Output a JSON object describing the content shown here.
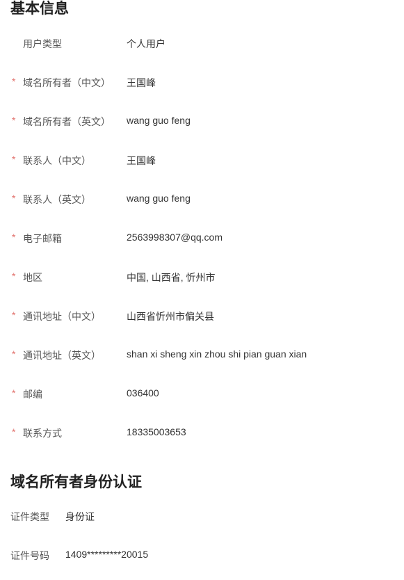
{
  "colors": {
    "required_marker": "#e2726d",
    "label": "#555555",
    "value": "#333333",
    "title": "#222222"
  },
  "basic_info": {
    "title": "基本信息",
    "required_marker": "*",
    "rows": [
      {
        "label": "用户类型",
        "value": "个人用户",
        "required": false
      },
      {
        "label": "域名所有者（中文）",
        "value": "王国峰",
        "required": true
      },
      {
        "label": "域名所有者（英文）",
        "value": "wang guo feng",
        "required": true
      },
      {
        "label": "联系人（中文）",
        "value": "王国峰",
        "required": true
      },
      {
        "label": "联系人（英文）",
        "value": "wang guo feng",
        "required": true
      },
      {
        "label": "电子邮箱",
        "value": "2563998307@qq.com",
        "required": true
      },
      {
        "label": "地区",
        "value": "中国, 山西省, 忻州市",
        "required": true
      },
      {
        "label": "通讯地址（中文）",
        "value": "山西省忻州市偏关县",
        "required": true
      },
      {
        "label": "通讯地址（英文）",
        "value": "shan xi sheng xin zhou shi pian guan xian",
        "required": true
      },
      {
        "label": "邮编",
        "value": "036400",
        "required": true
      },
      {
        "label": "联系方式",
        "value": "18335003653",
        "required": true
      }
    ]
  },
  "owner_identity": {
    "title": "域名所有者身份认证",
    "rows": [
      {
        "label": "证件类型",
        "value": "身份证"
      },
      {
        "label": "证件号码",
        "value": "1409*********20015"
      }
    ]
  }
}
